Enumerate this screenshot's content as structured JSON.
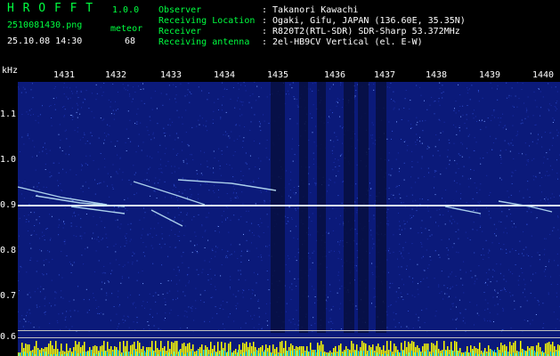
{
  "header": {
    "app_name": "H R O F F T",
    "version": "1.0.0",
    "file_name": "2510081430.png",
    "meteor_label": "meteor",
    "datetime": "25.10.08 14:30",
    "meteor_count": "68",
    "observer_label": "Observer",
    "observer_value": ": Takanori Kawachi",
    "location_label": "Receiving Location",
    "location_value": ": Ogaki, Gifu, JAPAN (136.60E, 35.35N)",
    "receiver_label": "Receiver",
    "receiver_value": ": R820T2(RTL-SDR) SDR-Sharp 53.372MHz",
    "antenna_label": "Receiving antenna",
    "antenna_value": ": 2el-HB9CV Vertical (el. E-W)"
  },
  "axes": {
    "unit": "kHz",
    "x_ticks": [
      "1431",
      "1432",
      "1433",
      "1434",
      "1435",
      "1436",
      "1437",
      "1438",
      "1439",
      "1440"
    ],
    "y_ticks": [
      "1.1",
      "1.0",
      "0.9",
      "0.8",
      "0.7",
      "0.6"
    ],
    "bottom_label": "0.6"
  },
  "colors": {
    "background": "#000000",
    "spectrogram": "#0b1a7a",
    "header_green": "#00ff40",
    "signal": "#c8f0ff",
    "yellow_bars": "#ffff00",
    "cyan_bars": "#00e0ff"
  }
}
